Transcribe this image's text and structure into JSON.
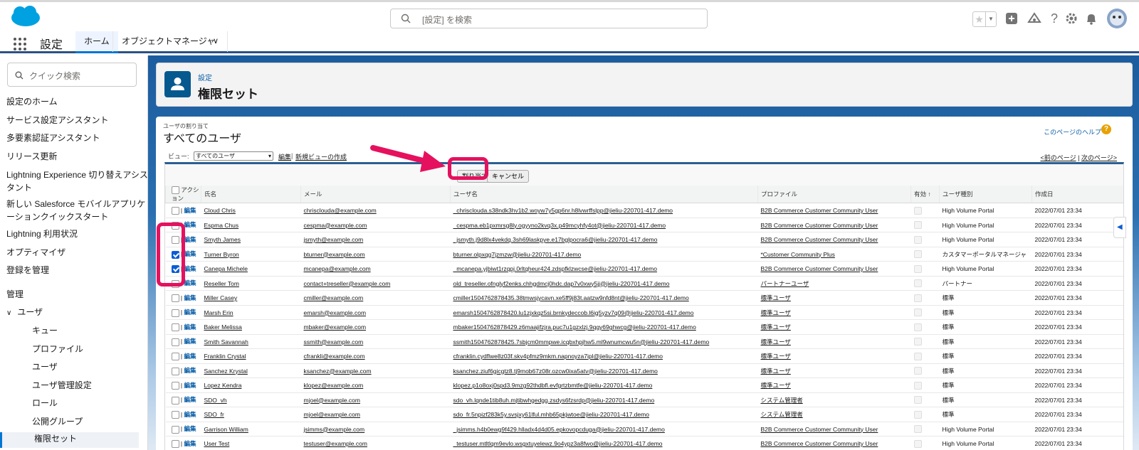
{
  "header": {
    "search_placeholder": "[設定] を検索"
  },
  "appnav": {
    "app_name": "設定",
    "tabs": [
      {
        "label": "ホーム"
      },
      {
        "label": "オブジェクトマネージャ"
      }
    ]
  },
  "sidebar": {
    "search_placeholder": "クイック検索",
    "items": [
      "設定のホーム",
      "サービス設定アシスタント",
      "多要素認証アシスタント",
      "リリース更新",
      "Lightning Experience 切り替えアシスタント",
      "新しい Salesforce モバイルアプリケーションクイックスタート",
      "Lightning 利用状況",
      "オプティマイザ",
      "登録を管理"
    ],
    "section_admin": "管理",
    "group_users": "ユーザ",
    "sub_items": [
      "キュー",
      "プロファイル",
      "ユーザ",
      "ユーザ管理設定",
      "ロール",
      "公開グループ",
      "権限セット"
    ]
  },
  "page_header": {
    "breadcrumb": "設定",
    "title": "権限セット"
  },
  "main": {
    "label": "ユーザの割り当て",
    "title": "すべてのユーザ",
    "help_link": "このページのヘルプ",
    "view_label": "ビュー:",
    "view_selected": "すべてのユーザ",
    "edit_link": "編集",
    "new_view_link": "新規ビューの作成",
    "prev_page": "<前のページ",
    "next_page": "次のページ>",
    "assign_button": "割り当て",
    "cancel_button": "キャンセル",
    "columns": [
      "アクション",
      "氏名",
      "メール",
      "ユーザ名",
      "プロファイル",
      "有効 ↑",
      "ユーザ種別",
      "作成日"
    ],
    "edit_label": "編集",
    "rows": [
      {
        "name": "Cloud Chris",
        "email": "chrisclouda@example.com",
        "username": "_chrisclouda.s38ndk3hv1b2.woyw7y5gp6nr.h8lvwrffslpp@jieliu-220701-417.demo",
        "profile": "B2B Commerce Customer Community User",
        "type": "High Volume Portal",
        "created": "2022/07/01 23:34",
        "checked": false
      },
      {
        "name": "Espma Chus",
        "email": "cespma@example.com",
        "username": "_cespma.eb1pxmrsg8ly.ogyyno2kvq3x.p49mcyhfy4ot@jieliu-220701-417.demo",
        "profile": "B2B Commerce Customer Community User",
        "type": "High Volume Portal",
        "created": "2022/07/01 23:34",
        "checked": false
      },
      {
        "name": "Smyth James",
        "email": "jsmyth@example.com",
        "username": "_jsmyth.j9d8lx4vekdq.3sh69laskpye.e17bglpocra6@jieliu-220701-417.demo",
        "profile": "B2B Commerce Customer Community User",
        "type": "High Volume Portal",
        "created": "2022/07/01 23:34",
        "checked": false
      },
      {
        "name": "Turner Byron",
        "email": "bturner@example.com",
        "username": "bturner.olpxqg7jzmzw@jieliu-220701-417.demo",
        "profile": "*Customer Community Plus",
        "type": "カスタマーポータルマネージャ",
        "created": "2022/07/01 23:34",
        "checked": true
      },
      {
        "name": "Canepa Michele",
        "email": "mcanepa@example.com",
        "username": "_mcanepa.yjbiwt1rzqpj.0rltqheur424.zdspfklzwcse@jieliu-220701-417.demo",
        "profile": "B2B Commerce Customer Community User",
        "type": "High Volume Portal",
        "created": "2022/07/01 23:34",
        "checked": true
      },
      {
        "name": "Reseller Tom",
        "email": "contact+treseller@example.com",
        "username": "old_treseller.ofnglyf2enks.chhgdmcj0hdc.dap7v0xwy5jj@jieliu-220701-417.demo",
        "profile": "パートナーユーザ",
        "type": "パートナー",
        "created": "2022/07/01 23:34",
        "checked": false
      },
      {
        "name": "Miller Casey",
        "email": "cmiller@example.com",
        "username": "cmiller1504762878435.38tmwsjycavn.xe5ff9j83t.aatzw9nfd8nt@jieliu-220701-417.demo",
        "profile": "標準ユーザ",
        "type": "標準",
        "created": "2022/07/01 23:34",
        "checked": false
      },
      {
        "name": "Marsh Erin",
        "email": "emarsh@example.com",
        "username": "emarsh1504762878420.lu1zjxkqz5si.brnkydeccob.l6ig5yzv7q09@jieliu-220701-417.demo",
        "profile": "標準ユーザ",
        "type": "標準",
        "created": "2022/07/01 23:34",
        "checked": false
      },
      {
        "name": "Baker Melissa",
        "email": "mbaker@example.com",
        "username": "mbaker1504762878429.z6maajifzjra.puc7u1gzxlzj.9qgy69ghwcg@jieliu-220701-417.demo",
        "profile": "標準ユーザ",
        "type": "標準",
        "created": "2022/07/01 23:34",
        "checked": false
      },
      {
        "name": "Smith Savannah",
        "email": "ssmith@example.com",
        "username": "ssmith1504762878425.7sbjcm0mmpwe.icqbxhpjhw5.ml9wnumcwu5n@jieliu-220701-417.demo",
        "profile": "標準ユーザ",
        "type": "標準",
        "created": "2022/07/01 23:34",
        "checked": false
      },
      {
        "name": "Franklin Crystal",
        "email": "cfrankli@example.com",
        "username": "cfranklin.cydflwe8z03f.skv4pfmz9mkm.napnoyza7ipl@jieliu-220701-417.demo",
        "profile": "標準ユーザ",
        "type": "標準",
        "created": "2022/07/01 23:34",
        "checked": false
      },
      {
        "name": "Sanchez Krystal",
        "email": "ksanchez@example.com",
        "username": "ksanchez.ziuf6gicgtz8.tj9mob67z08r.ozcw0ixa5atv@jieliu-220701-417.demo",
        "profile": "標準ユーザ",
        "type": "標準",
        "created": "2022/07/01 23:34",
        "checked": false
      },
      {
        "name": "Lopez Kendra",
        "email": "klopez@example.com",
        "username": "klopez.p1o8oxj0spd3.9mzg92thdbfl.evfgrtzbmtfe@jieliu-220701-417.demo",
        "profile": "標準ユーザ",
        "type": "標準",
        "created": "2022/07/01 23:34",
        "checked": false
      },
      {
        "name": "SDO_vh",
        "email": "mjoel@example.com",
        "username": "sdo_vh.lqnde1tib8uh.mjtibwhgedgg.zsdys6fzsrdp@jieliu-220701-417.demo",
        "profile": "システム管理者",
        "type": "標準",
        "created": "2022/07/01 23:34",
        "checked": false
      },
      {
        "name": "SDO_fr",
        "email": "mjoel@example.com",
        "username": "sdo_fr.5npizf283k5y.svsjxy61lful.mhb65pkjwtoe@jieliu-220701-417.demo",
        "profile": "システム管理者",
        "type": "標準",
        "created": "2022/07/01 23:34",
        "checked": false
      },
      {
        "name": "Garrison William",
        "email": "jsimms@example.com",
        "username": "_jsimms.h4b0ewg9f429.hlladx4d4d05.epkovopcduga@jieliu-220701-417.demo",
        "profile": "B2B Commerce Customer Community User",
        "type": "High Volume Portal",
        "created": "2022/07/01 23:34",
        "checked": false
      },
      {
        "name": "User Test",
        "email": "testuser@example.com",
        "username": "_testuser.mtltlqm9evlo.wsgxtuyelewz.9o4ypz3a8fwo@jieliu-220701-417.demo",
        "profile": "B2B Commerce Customer Community User",
        "type": "High Volume Portal",
        "created": "2022/07/01 23:34",
        "checked": false
      }
    ]
  },
  "colors": {
    "brand": "#0176d3",
    "highlight": "#e5115e",
    "checked": "#0b5cd5"
  }
}
